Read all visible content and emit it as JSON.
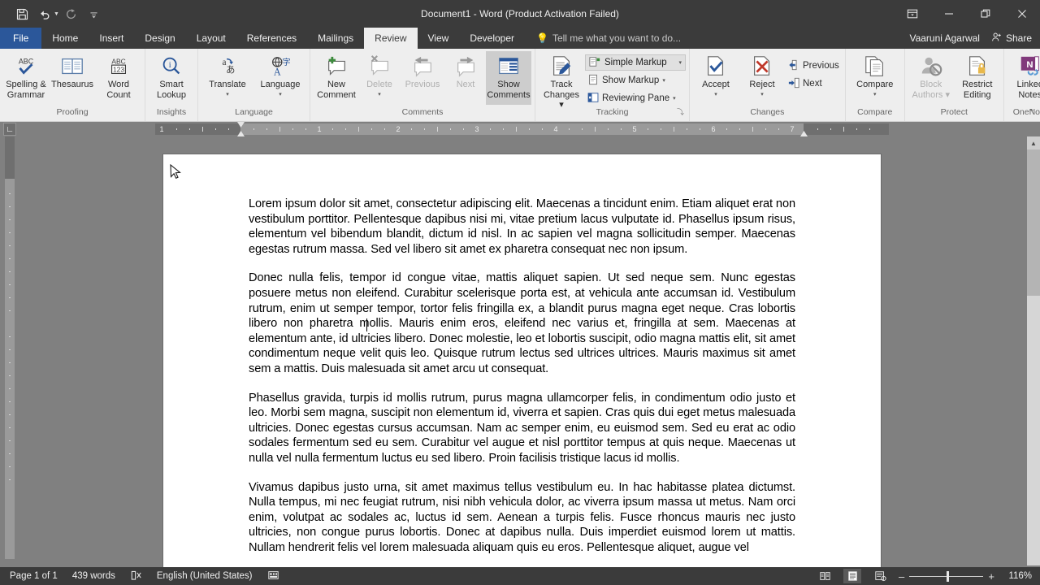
{
  "window": {
    "title": "Document1 - Word (Product Activation Failed)",
    "minimize_label": "–",
    "restore_label": "❐",
    "close_label": "✕",
    "ribbon_display_label": "⬚"
  },
  "quick_access": {
    "save": "save-icon",
    "undo": "undo-icon",
    "redo": "redo-icon",
    "customize": "customize-icon"
  },
  "tabs": [
    {
      "label": "File",
      "active": false
    },
    {
      "label": "Home",
      "active": false
    },
    {
      "label": "Insert",
      "active": false
    },
    {
      "label": "Design",
      "active": false
    },
    {
      "label": "Layout",
      "active": false
    },
    {
      "label": "References",
      "active": false
    },
    {
      "label": "Mailings",
      "active": false
    },
    {
      "label": "Review",
      "active": true
    },
    {
      "label": "View",
      "active": false
    },
    {
      "label": "Developer",
      "active": false
    }
  ],
  "tell_me": {
    "placeholder": "Tell me what you want to do...",
    "icon": "lightbulb-icon"
  },
  "account": {
    "user_name": "Vaaruni Agarwal",
    "share_label": "Share"
  },
  "ribbon": {
    "collapse_label": "⌃",
    "groups": [
      {
        "name": "Proofing",
        "label": "Proofing",
        "buttons": [
          {
            "label": "Spelling &\nGrammar",
            "line1": "Spelling &",
            "line2": "Grammar",
            "icon": "spelling-grammar-icon",
            "state": "enabled"
          },
          {
            "label": "Thesaurus",
            "line1": "Thesaurus",
            "line2": "",
            "icon": "thesaurus-icon",
            "state": "enabled"
          },
          {
            "label": "Word Count",
            "line1": "Word",
            "line2": "Count",
            "icon": "word-count-icon",
            "state": "enabled"
          }
        ]
      },
      {
        "name": "Insights",
        "label": "Insights",
        "buttons": [
          {
            "line1": "Smart",
            "line2": "Lookup",
            "icon": "smart-lookup-icon",
            "state": "enabled"
          }
        ]
      },
      {
        "name": "Language",
        "label": "Language",
        "buttons": [
          {
            "line1": "Translate",
            "line2": "▾",
            "icon": "translate-icon",
            "state": "enabled"
          },
          {
            "line1": "Language",
            "line2": "▾",
            "icon": "language-icon",
            "state": "enabled"
          }
        ]
      },
      {
        "name": "Comments",
        "label": "Comments",
        "buttons": [
          {
            "line1": "New",
            "line2": "Comment",
            "icon": "new-comment-icon",
            "state": "enabled"
          },
          {
            "line1": "Delete",
            "line2": "▾",
            "icon": "delete-comment-icon",
            "state": "disabled"
          },
          {
            "line1": "Previous",
            "line2": "",
            "icon": "previous-comment-icon",
            "state": "disabled"
          },
          {
            "line1": "Next",
            "line2": "",
            "icon": "next-comment-icon",
            "state": "disabled"
          },
          {
            "line1": "Show",
            "line2": "Comments",
            "icon": "show-comments-icon",
            "state": "selected"
          }
        ]
      },
      {
        "name": "Tracking",
        "label": "Tracking",
        "buttons": [
          {
            "line1": "Track",
            "line2": "Changes ▾",
            "icon": "track-changes-icon",
            "state": "enabled"
          }
        ],
        "small_items": [
          {
            "label": "Simple Markup",
            "icon": "markup-display-icon",
            "type": "combo",
            "caret": "▾"
          },
          {
            "label": "Show Markup",
            "icon": "show-markup-icon",
            "type": "menu",
            "caret": "▾"
          },
          {
            "label": "Reviewing Pane",
            "icon": "reviewing-pane-icon",
            "type": "menu",
            "caret": "▾"
          }
        ],
        "dialog_launcher": "⤵"
      },
      {
        "name": "Changes",
        "label": "Changes",
        "buttons": [
          {
            "line1": "Accept",
            "line2": "▾",
            "icon": "accept-change-icon",
            "state": "enabled"
          },
          {
            "line1": "Reject",
            "line2": "▾",
            "icon": "reject-change-icon",
            "state": "enabled"
          }
        ],
        "small_items": [
          {
            "label": "Previous",
            "icon": "previous-change-icon",
            "type": "menu",
            "caret": ""
          },
          {
            "label": "Next",
            "icon": "next-change-icon",
            "type": "menu",
            "caret": ""
          }
        ]
      },
      {
        "name": "Compare",
        "label": "Compare",
        "buttons": [
          {
            "line1": "Compare",
            "line2": "▾",
            "icon": "compare-icon",
            "state": "enabled"
          }
        ]
      },
      {
        "name": "Protect",
        "label": "Protect",
        "buttons": [
          {
            "line1": "Block",
            "line2": "Authors ▾",
            "icon": "block-authors-icon",
            "state": "disabled"
          },
          {
            "line1": "Restrict",
            "line2": "Editing",
            "icon": "restrict-editing-icon",
            "state": "enabled"
          }
        ]
      },
      {
        "name": "OneNote",
        "label": "OneNote",
        "buttons": [
          {
            "line1": "Linked",
            "line2": "Notes",
            "icon": "linked-notes-icon",
            "state": "enabled"
          }
        ]
      }
    ]
  },
  "ruler": {
    "horizontal_numbers": [
      "1",
      "1",
      "2",
      "3",
      "4",
      "5",
      "6",
      "7"
    ],
    "tab_selector_icon": "left-tab-stop-icon"
  },
  "document": {
    "paragraphs": [
      "Lorem ipsum dolor sit amet, consectetur adipiscing elit. Maecenas a tincidunt enim. Etiam aliquet erat non vestibulum porttitor. Pellentesque dapibus nisi mi, vitae pretium lacus vulputate id. Phasellus ipsum risus, elementum vel bibendum blandit, dictum id nisl. In ac sapien vel magna sollicitudin semper. Maecenas egestas rutrum massa. Sed vel libero sit amet ex pharetra consequat nec non ipsum.",
      "Donec nulla felis, tempor id congue vitae, mattis aliquet sapien. Ut sed neque sem. Nunc egestas posuere metus non eleifend. Curabitur scelerisque porta est, at vehicula ante accumsan id. Vestibulum rutrum, enim ut semper tempor, tortor felis fringilla ex, a blandit purus magna eget neque. Cras lobortis libero non pharetra mollis. Mauris enim eros, eleifend nec varius et, fringilla at sem. Maecenas at elementum ante, id ultricies libero. Donec molestie, leo et lobortis suscipit, odio magna mattis elit, sit amet condimentum neque velit quis leo. Quisque rutrum lectus sed ultrices ultrices. Mauris maximus sit amet sem a mattis. Duis malesuada sit amet arcu ut consequat.",
      "Phasellus gravida, turpis id mollis rutrum, purus magna ullamcorper felis, in condimentum odio justo et leo. Morbi sem magna, suscipit non elementum id, viverra et sapien. Cras quis dui eget metus malesuada ultricies. Donec egestas cursus accumsan. Nam ac semper enim, eu euismod sem. Sed eu erat ac odio sodales fermentum sed eu sem. Curabitur vel augue et nisl porttitor tempus at quis neque. Maecenas ut nulla vel nulla fermentum luctus eu sed libero. Proin facilisis tristique lacus id mollis.",
      "Vivamus dapibus justo urna, sit amet maximus tellus vestibulum eu. In hac habitasse platea dictumst. Nulla tempus, mi nec feugiat rutrum, nisi nibh vehicula dolor, ac viverra ipsum massa ut metus. Nam orci enim, volutpat ac sodales ac, luctus id sem. Aenean a turpis felis. Fusce rhoncus mauris nec justo ultricies, non congue purus lobortis. Donec at dapibus nulla. Duis imperdiet euismod lorem ut mattis. Nullam hendrerit felis vel lorem malesuada aliquam quis eu eros. Pellentesque aliquet, augue vel"
    ]
  },
  "scrollbar": {
    "up_arrow": "▲",
    "down_arrow": "▼"
  },
  "status_bar": {
    "page": "Page 1 of 1",
    "words": "439 words",
    "proofing_icon": "proofing-status-icon",
    "language": "English (United States)",
    "macro_icon": "macro-record-icon",
    "views": [
      {
        "name": "read-mode",
        "icon": "read-mode-icon",
        "active": false
      },
      {
        "name": "print-layout",
        "icon": "print-layout-icon",
        "active": true
      },
      {
        "name": "web-layout",
        "icon": "web-layout-icon",
        "active": false
      }
    ],
    "zoom_out": "–",
    "zoom_in": "+",
    "zoom_value": "116%"
  }
}
